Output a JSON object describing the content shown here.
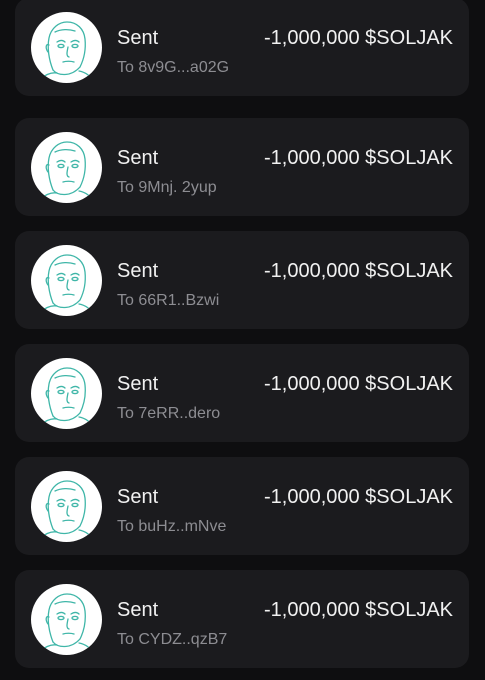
{
  "transactions": [
    {
      "status": "Sent",
      "recipient": "To 8v9G...a02G",
      "amount": "-1,000,000 $SOLJAK",
      "avatar_icon": "wojak-face-icon"
    },
    {
      "status": "Sent",
      "recipient": "To 9Mnj. 2yup",
      "amount": "-1,000,000 $SOLJAK",
      "avatar_icon": "wojak-face-icon"
    },
    {
      "status": "Sent",
      "recipient": "To 66R1..Bzwi",
      "amount": "-1,000,000 $SOLJAK",
      "avatar_icon": "wojak-face-icon"
    },
    {
      "status": "Sent",
      "recipient": "To 7eRR..dero",
      "amount": "-1,000,000 $SOLJAK",
      "avatar_icon": "wojak-face-icon"
    },
    {
      "status": "Sent",
      "recipient": "To buHz..mNve",
      "amount": "-1,000,000 $SOLJAK",
      "avatar_icon": "wojak-face-icon"
    },
    {
      "status": "Sent",
      "recipient": "To CYDZ..qzB7",
      "amount": "-1,000,000 $SOLJAK",
      "avatar_icon": "wojak-face-icon"
    }
  ],
  "colors": {
    "background": "#0e0e10",
    "card": "#1b1b1e",
    "primary_text": "#f1f1f1",
    "secondary_text": "#8d8d92",
    "avatar_line": "#3fb6a8"
  }
}
